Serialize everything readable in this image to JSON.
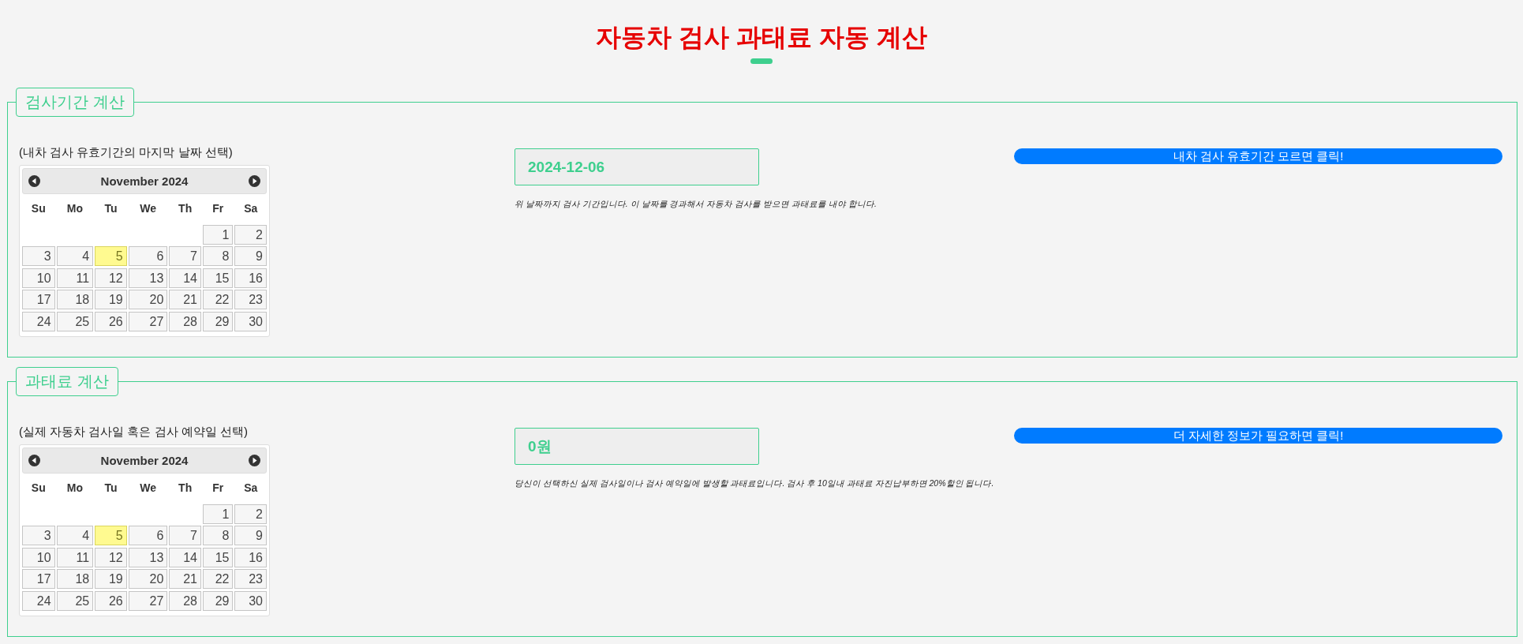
{
  "title": "자동차 검사 과태료 자동 계산",
  "sections": [
    {
      "legend": "검사기간 계산",
      "prompt": "(내차 검사 유효기간의 마지막 날짜 선택)",
      "calendar": {
        "month": "November 2024",
        "weekdays": [
          "Su",
          "Mo",
          "Tu",
          "We",
          "Th",
          "Fr",
          "Sa"
        ],
        "weeks": [
          [
            {
              "day": "1",
              "selected": false
            },
            {
              "day": "2",
              "selected": false
            }
          ],
          [
            {
              "day": "3",
              "selected": false
            },
            {
              "day": "4",
              "selected": false
            },
            {
              "day": "5",
              "selected": true
            },
            {
              "day": "6",
              "selected": false
            },
            {
              "day": "7",
              "selected": false
            },
            {
              "day": "8",
              "selected": false
            },
            {
              "day": "9",
              "selected": false
            }
          ],
          [
            {
              "day": "10",
              "selected": false
            },
            {
              "day": "11",
              "selected": false
            },
            {
              "day": "12",
              "selected": false
            },
            {
              "day": "13",
              "selected": false
            },
            {
              "day": "14",
              "selected": false
            },
            {
              "day": "15",
              "selected": false
            },
            {
              "day": "16",
              "selected": false
            }
          ],
          [
            {
              "day": "17",
              "selected": false
            },
            {
              "day": "18",
              "selected": false
            },
            {
              "day": "19",
              "selected": false
            },
            {
              "day": "20",
              "selected": false
            },
            {
              "day": "21",
              "selected": false
            },
            {
              "day": "22",
              "selected": false
            },
            {
              "day": "23",
              "selected": false
            }
          ],
          [
            {
              "day": "24",
              "selected": false
            },
            {
              "day": "25",
              "selected": false
            },
            {
              "day": "26",
              "selected": false
            },
            {
              "day": "27",
              "selected": false
            },
            {
              "day": "28",
              "selected": false
            },
            {
              "day": "29",
              "selected": false
            },
            {
              "day": "30",
              "selected": false
            }
          ]
        ]
      },
      "result": "2024-12-06",
      "note": "위 날짜까지 검사 기간입니다. 이 날짜를 경과해서 자동차 검사를 받으면 과태료를 내야 합니다.",
      "button": "내차 검사 유효기간 모르면 클릭!"
    },
    {
      "legend": "과태료 계산",
      "prompt": "(실제 자동차 검사일 혹은 검사 예약일 선택)",
      "calendar": {
        "month": "November 2024",
        "weekdays": [
          "Su",
          "Mo",
          "Tu",
          "We",
          "Th",
          "Fr",
          "Sa"
        ],
        "weeks": [
          [
            {
              "day": "1",
              "selected": false
            },
            {
              "day": "2",
              "selected": false
            }
          ],
          [
            {
              "day": "3",
              "selected": false
            },
            {
              "day": "4",
              "selected": false
            },
            {
              "day": "5",
              "selected": true
            },
            {
              "day": "6",
              "selected": false
            },
            {
              "day": "7",
              "selected": false
            },
            {
              "day": "8",
              "selected": false
            },
            {
              "day": "9",
              "selected": false
            }
          ],
          [
            {
              "day": "10",
              "selected": false
            },
            {
              "day": "11",
              "selected": false
            },
            {
              "day": "12",
              "selected": false
            },
            {
              "day": "13",
              "selected": false
            },
            {
              "day": "14",
              "selected": false
            },
            {
              "day": "15",
              "selected": false
            },
            {
              "day": "16",
              "selected": false
            }
          ],
          [
            {
              "day": "17",
              "selected": false
            },
            {
              "day": "18",
              "selected": false
            },
            {
              "day": "19",
              "selected": false
            },
            {
              "day": "20",
              "selected": false
            },
            {
              "day": "21",
              "selected": false
            },
            {
              "day": "22",
              "selected": false
            },
            {
              "day": "23",
              "selected": false
            }
          ],
          [
            {
              "day": "24",
              "selected": false
            },
            {
              "day": "25",
              "selected": false
            },
            {
              "day": "26",
              "selected": false
            },
            {
              "day": "27",
              "selected": false
            },
            {
              "day": "28",
              "selected": false
            },
            {
              "day": "29",
              "selected": false
            },
            {
              "day": "30",
              "selected": false
            }
          ]
        ]
      },
      "result": "0원",
      "note": "당신이 선택하신 실제 검사일이나 검사 예약일에 발생할 과태료입니다. 검사 후 10일내 과태료 자진납부하면 20%할인 됩니다.",
      "button": "더 자세한 정보가 필요하면 클릭!"
    }
  ]
}
